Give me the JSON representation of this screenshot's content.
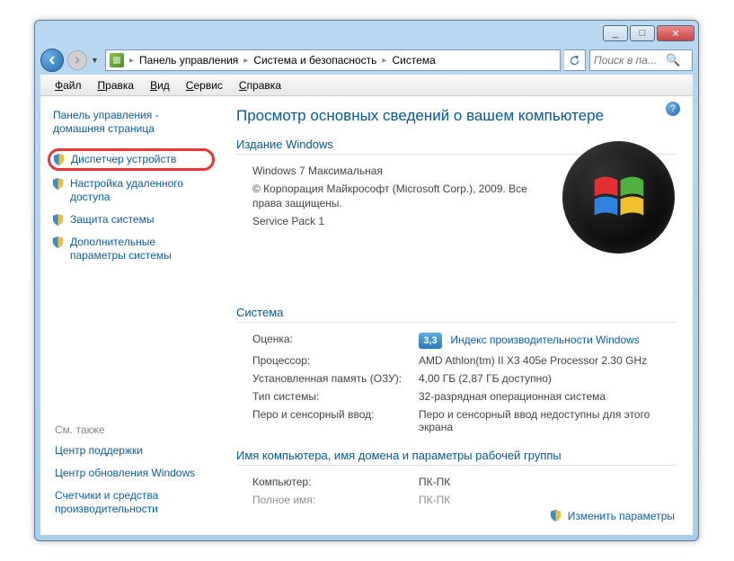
{
  "titlebar": {
    "min": "_",
    "max": "□",
    "close": "✕"
  },
  "breadcrumb": {
    "items": [
      "Панель управления",
      "Система и безопасность",
      "Система"
    ],
    "search_placeholder": "Поиск в па..."
  },
  "menubar": {
    "file": "айл",
    "file_u": "Ф",
    "edit": "равка",
    "edit_u": "П",
    "view": "ид",
    "view_u": "В",
    "tools": "ервис",
    "tools_u": "С",
    "help": "правка",
    "help_u": "С"
  },
  "sidebar": {
    "home": "Панель управления - домашняя страница",
    "device_manager": "Диспетчер устройств",
    "remote_settings": "Настройка удаленного доступа",
    "system_protection": "Защита системы",
    "advanced": "Дополнительные параметры системы",
    "see_also": "См. также",
    "support": "Центр поддержки",
    "wu": "Центр обновления Windows",
    "perf": "Счетчики и средства производительности"
  },
  "main": {
    "title": "Просмотр основных сведений о вашем компьютере",
    "edition_head": "Издание Windows",
    "edition_name": "Windows 7 Максимальная",
    "copyright": "© Корпорация Майкрософт (Microsoft Corp.), 2009. Все права защищены.",
    "service_pack": "Service Pack 1",
    "system_head": "Система",
    "rating_label": "Оценка:",
    "rating_value": "3,3",
    "rating_link": "Индекс производительности Windows",
    "cpu_label": "Процессор:",
    "cpu_value": "AMD Athlon(tm) II X3 405e Processor   2.30 GHz",
    "ram_label": "Установленная память (ОЗУ):",
    "ram_value": "4,00 ГБ (2,87 ГБ доступно)",
    "type_label": "Тип системы:",
    "type_value": "32-разрядная операционная система",
    "pen_label": "Перо и сенсорный ввод:",
    "pen_value": "Перо и сенсорный ввод недоступны для этого экрана",
    "workgroup_head": "Имя компьютера, имя домена и параметры рабочей группы",
    "computer_label": "Компьютер:",
    "computer_value": "ПК-ПК",
    "fullname_label": "Полное имя:",
    "fullname_value": "ПК-ПК",
    "change_link": "Изменить параметры"
  }
}
